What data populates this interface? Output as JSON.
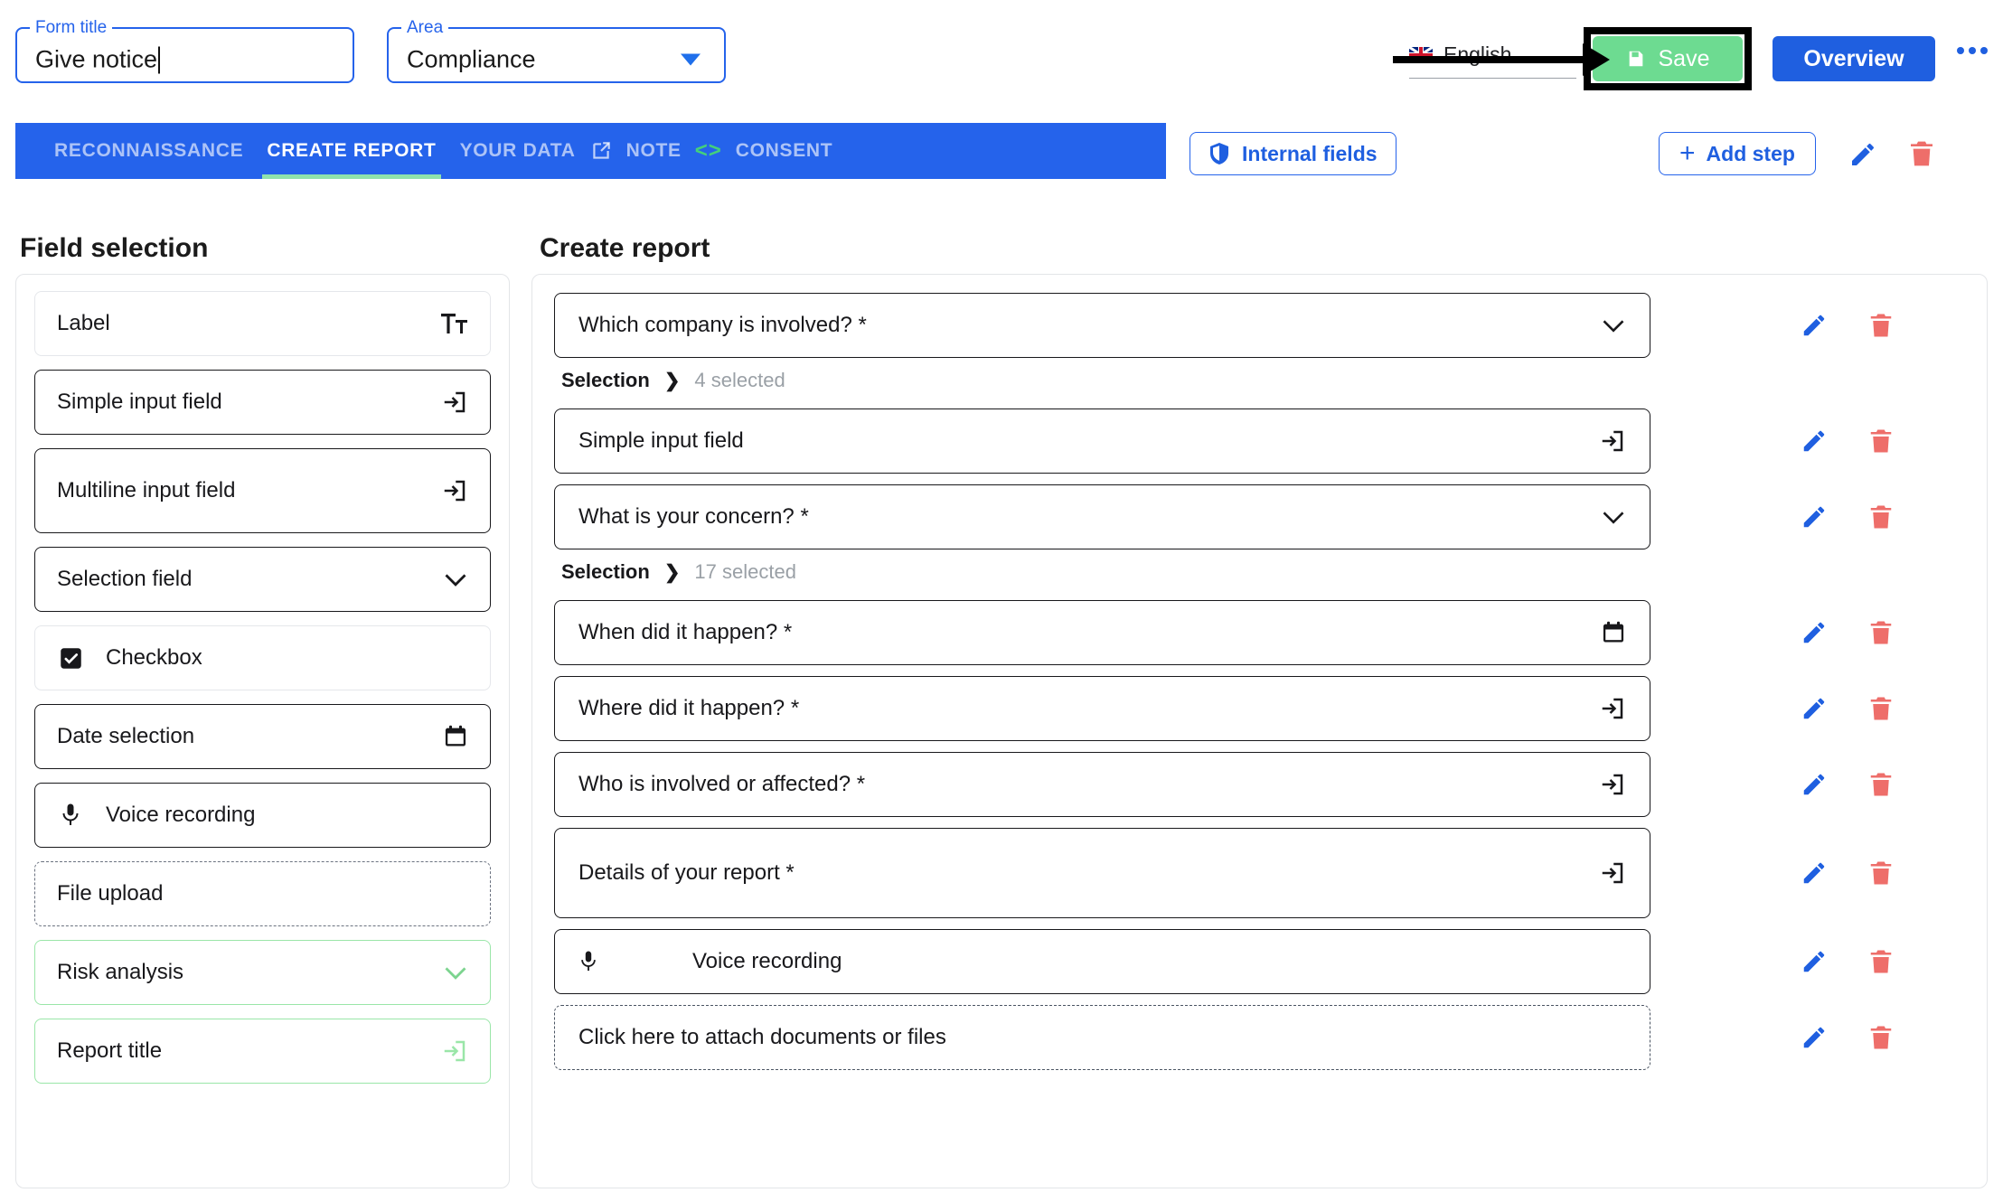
{
  "header": {
    "form_title_legend": "Form title",
    "form_title_value": "Give notice",
    "area_legend": "Area",
    "area_value": "Compliance",
    "language": "English",
    "save_label": "Save",
    "overview_label": "Overview",
    "more_label": "…"
  },
  "tabs": [
    {
      "label": "RECONNAISSANCE",
      "active": false
    },
    {
      "label": "CREATE REPORT",
      "active": true
    },
    {
      "label": "YOUR DATA",
      "active": false
    },
    {
      "label": "NOTE",
      "active": false
    },
    {
      "label": "CONSENT",
      "active": false
    }
  ],
  "toolbar": {
    "internal_fields_label": "Internal fields",
    "add_step_label": "Add step",
    "add_step_plus": "+"
  },
  "field_selection": {
    "title": "Field selection",
    "items": [
      {
        "label": "Label",
        "icon": "text-format-icon",
        "style": "soft"
      },
      {
        "label": "Simple input field",
        "icon": "input-icon",
        "style": "solid"
      },
      {
        "label": "Multiline input field",
        "icon": "input-icon",
        "style": "solid"
      },
      {
        "label": "Selection field",
        "icon": "chevron-down-icon",
        "style": "solid"
      },
      {
        "label": "Checkbox",
        "icon": "checkbox-icon",
        "style": "soft"
      },
      {
        "label": "Date selection",
        "icon": "calendar-icon",
        "style": "solid"
      },
      {
        "label": "Voice recording",
        "icon": "microphone-icon",
        "style": "solid"
      },
      {
        "label": "File upload",
        "icon": "none",
        "style": "dashed"
      },
      {
        "label": "Risk analysis",
        "icon": "chevron-down-icon",
        "style": "green"
      },
      {
        "label": "Report title",
        "icon": "input-icon",
        "style": "green"
      }
    ]
  },
  "create_report": {
    "title": "Create report",
    "rows": [
      {
        "type": "field",
        "label": "Which company is involved? *",
        "icon": "chevron-down-icon",
        "has_code": false,
        "tall": false
      },
      {
        "type": "breadcrumb",
        "label": "Selection",
        "separator": "›",
        "count": "4 selected"
      },
      {
        "type": "field",
        "label": "Simple input field",
        "icon": "input-icon",
        "has_code": false,
        "tall": false
      },
      {
        "type": "field",
        "label": "What is your concern? *",
        "icon": "chevron-down-icon",
        "has_code": false,
        "tall": false
      },
      {
        "type": "breadcrumb",
        "label": "Selection",
        "separator": "›",
        "count": "17 selected"
      },
      {
        "type": "field",
        "label": "When did it happen? *",
        "icon": "calendar-icon",
        "has_code": true,
        "tall": false
      },
      {
        "type": "field",
        "label": "Where did it happen? *",
        "icon": "input-icon",
        "has_code": true,
        "tall": false
      },
      {
        "type": "field",
        "label": "Who is involved or affected? *",
        "icon": "input-icon",
        "has_code": true,
        "tall": false
      },
      {
        "type": "field",
        "label": "Details of your report *",
        "icon": "input-icon",
        "has_code": false,
        "tall": true
      },
      {
        "type": "voice",
        "label": "Voice recording",
        "icon": "microphone-icon",
        "has_code": false,
        "tall": false
      },
      {
        "type": "upload",
        "label": "Click here to attach documents or files",
        "icon": "none",
        "has_code": false,
        "tall": false
      }
    ],
    "code_icon_label": "< >"
  },
  "colors": {
    "primary_blue": "#2563eb",
    "tab_bar_blue": "#2563eb",
    "save_green": "#6ddb91",
    "active_tab_underline": "#8fe3ac",
    "danger_red": "#ee6e6a",
    "accent_green": "#9ae6a8",
    "muted_gray": "#9aa0a6"
  }
}
